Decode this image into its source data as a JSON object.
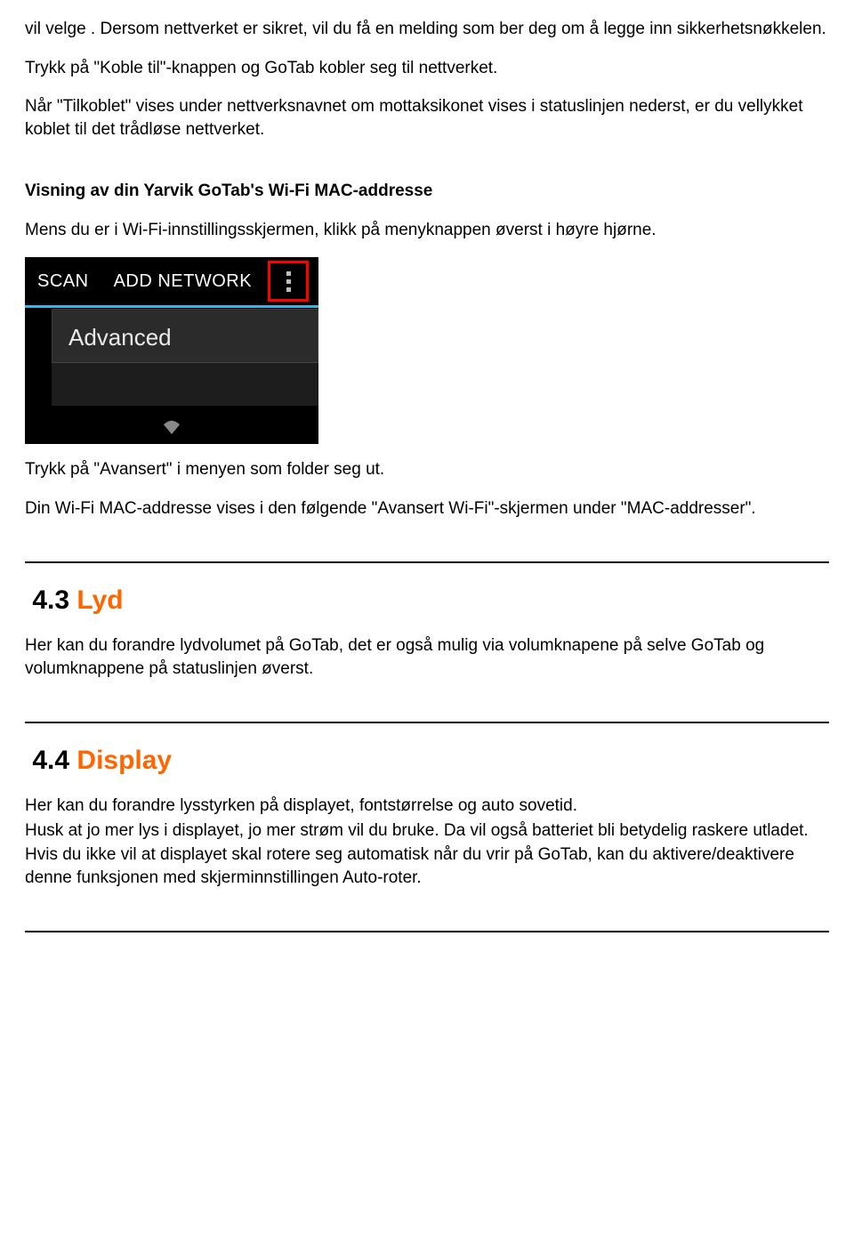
{
  "intro": {
    "p1": "vil velge . Dersom nettverket er sikret, vil du få en melding som ber deg om å legge inn sikkerhetsnøkkelen.",
    "p2": "Trykk på \"Koble til\"-knappen og GoTab kobler seg til nettverket.",
    "p3": "Når \"Tilkoblet\" vises under nettverksnavnet om mottaksikonet vises i statuslinjen nederst, er du vellykket koblet til det trådløse nettverket."
  },
  "mac": {
    "heading": "Visning av din Yarvik GoTab's Wi-Fi MAC-addresse",
    "p1": "Mens du er i Wi-Fi-innstillingsskjermen, klikk på menyknappen øverst i høyre hjørne.",
    "p2": "Trykk på \"Avansert\" i menyen som folder seg ut.",
    "p3": "Din Wi-Fi MAC-addresse vises i den følgende \"Avansert Wi-Fi\"-skjermen under \"MAC-addresser\"."
  },
  "android_shot": {
    "scan": "SCAN",
    "add_network": "ADD NETWORK",
    "advanced": "Advanced"
  },
  "section_43": {
    "num": "4.3",
    "title": "Lyd",
    "body": "Her kan du forandre lydvolumet på GoTab, det er også mulig via volumknapene på selve GoTab og volumknappene på statuslinjen øverst."
  },
  "section_44": {
    "num": "4.4",
    "title": "Display",
    "p1": "Her kan du forandre lysstyrken på displayet, fontstørrelse og auto sovetid.",
    "p2": "Husk at jo mer lys i displayet, jo mer strøm vil du bruke. Da vil også batteriet bli betydelig raskere utladet.",
    "p3": "Hvis du ikke vil at displayet skal rotere seg automatisk når du vrir på GoTab, kan du aktivere/deaktivere denne funksjonen med skjerminnstillingen Auto-roter."
  }
}
